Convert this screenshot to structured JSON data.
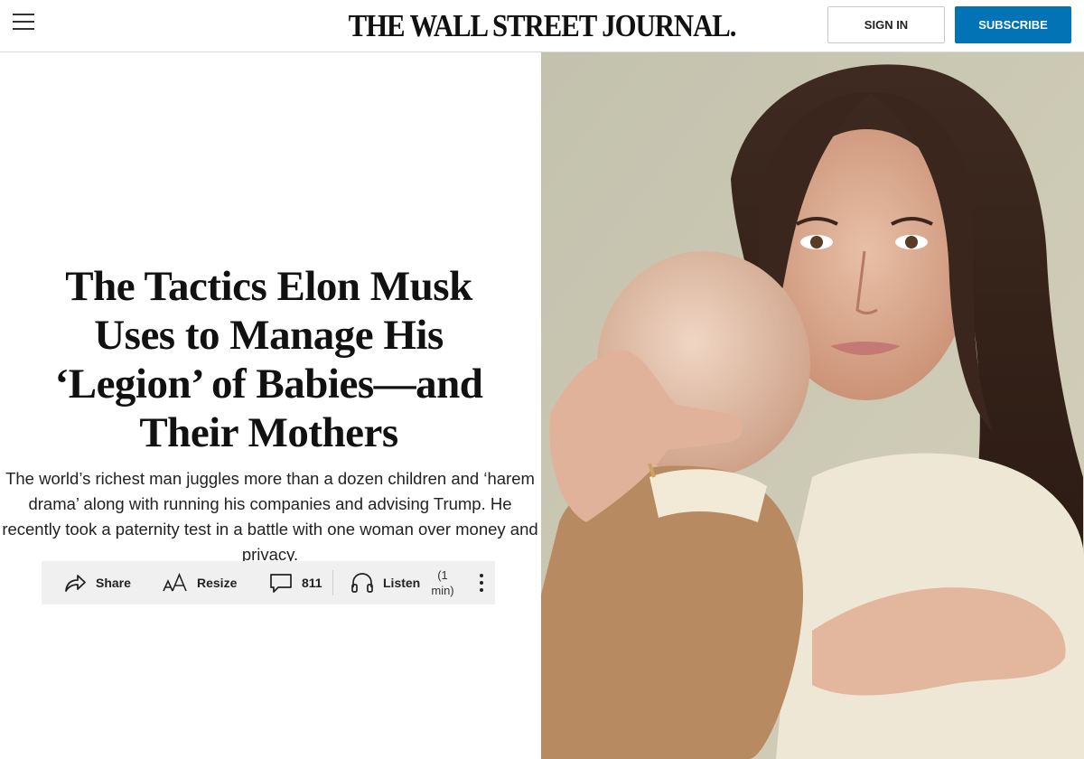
{
  "header": {
    "menu_icon": "hamburger-menu-icon",
    "masthead": "THE WALL STREET JOURNAL.",
    "signin_label": "SIGN IN",
    "subscribe_label": "SUBSCRIBE",
    "subscribe_color": "#0274b6"
  },
  "article": {
    "headline": "The Tactics Elon Musk Uses to Manage His ‘Legion’ of Babies—and Their Mothers",
    "dek": "The world’s richest man juggles more than a dozen children and ‘harem drama’ along with running his companies and advising Trump. He recently took a paternity test in a battle with one woman over money and privacy."
  },
  "toolbar": {
    "share_label": "Share",
    "share_icon": "share-arrow-icon",
    "resize_label": "Resize",
    "resize_icon": "text-resize-icon",
    "comments_count": "811",
    "comments_icon": "comment-bubble-icon",
    "listen_label": "Listen",
    "listen_icon": "headphones-icon",
    "listen_duration_line1": "(1",
    "listen_duration_line2": "min)",
    "more_icon": "more-vertical-icon"
  },
  "hero": {
    "image_icon": "photo-woman-holding-baby"
  }
}
